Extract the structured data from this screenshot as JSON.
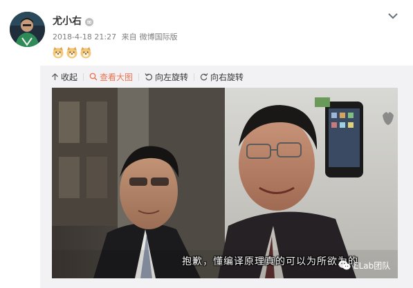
{
  "post": {
    "author": "尤小右",
    "badge_icon": "vip-badge-icon",
    "timestamp": "2018-4-18 21:27",
    "source_prefix": "来自",
    "source": "微博国际版",
    "emojis": [
      "doge-emoji",
      "doge-emoji",
      "doge-emoji"
    ],
    "menu_icon": "chevron-down-icon"
  },
  "toolbar": {
    "collapse": "收起",
    "view_large": "查看大图",
    "rotate_left": "向左旋转",
    "rotate_right": "向右旋转"
  },
  "image": {
    "subtitle": "抱歉，懂编译原理真的可以为所欲为的",
    "watermark": "ELab团队"
  },
  "colors": {
    "accent": "#eb7350",
    "meta": "#808080",
    "media_bg": "#f2f2f5"
  }
}
